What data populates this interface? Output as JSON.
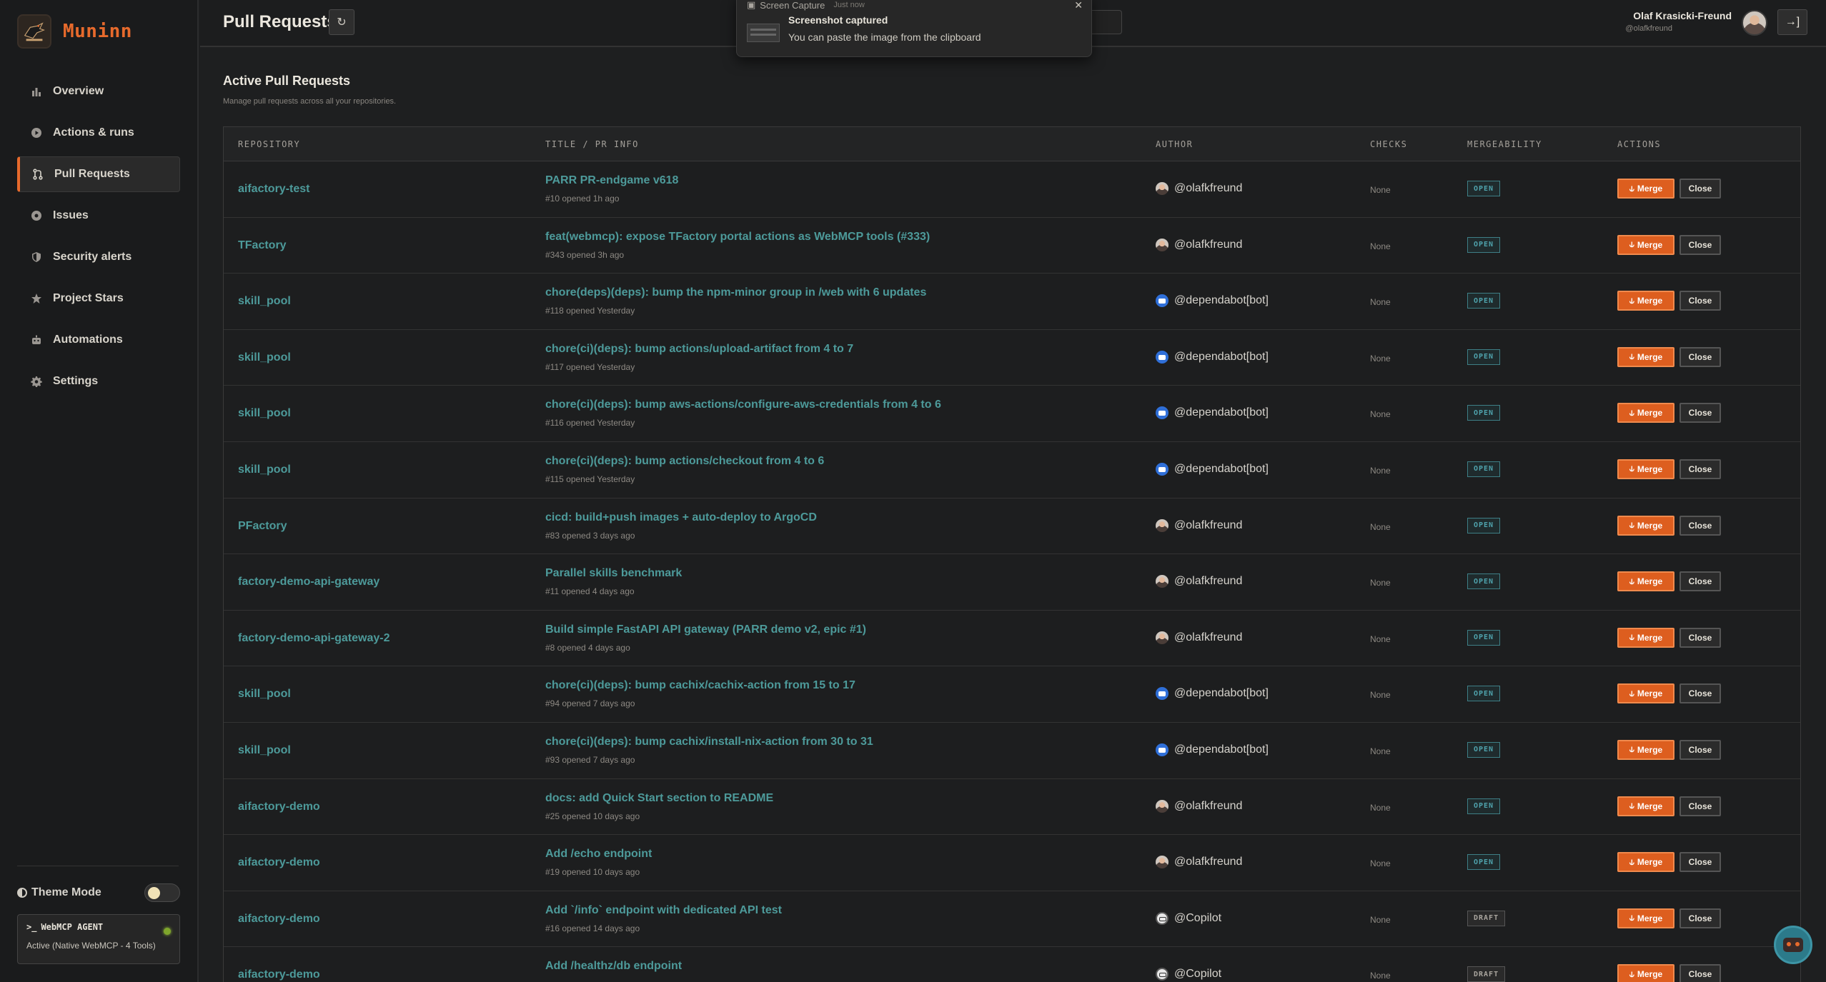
{
  "app": {
    "name": "Muninn"
  },
  "sidebar": {
    "items": [
      {
        "label": "Overview",
        "icon": "bar-chart-icon",
        "active": false
      },
      {
        "label": "Actions & runs",
        "icon": "play-circle-icon",
        "active": false
      },
      {
        "label": "Pull Requests",
        "icon": "git-pull-request-icon",
        "active": true
      },
      {
        "label": "Issues",
        "icon": "issue-dot-icon",
        "active": false
      },
      {
        "label": "Security alerts",
        "icon": "shield-icon",
        "active": false
      },
      {
        "label": "Project Stars",
        "icon": "star-icon",
        "active": false
      },
      {
        "label": "Automations",
        "icon": "robot-icon",
        "active": false
      },
      {
        "label": "Settings",
        "icon": "gear-icon",
        "active": false
      }
    ],
    "theme_label": "Theme Mode",
    "agent": {
      "title": "WebMCP AGENT",
      "status": "Active (Native WebMCP - 4 Tools)"
    }
  },
  "header": {
    "title": "Pull Requests",
    "user_name": "Olaf Krasicki-Freund",
    "user_handle": "@olafkfreund"
  },
  "toast": {
    "app": "Screen Capture",
    "time": "Just now",
    "title": "Screenshot captured",
    "body": "You can paste the image from the clipboard"
  },
  "main": {
    "title": "Active Pull Requests",
    "subtitle": "Manage pull requests across all your repositories.",
    "columns": [
      "REPOSITORY",
      "TITLE / PR INFO",
      "AUTHOR",
      "CHECKS",
      "MERGEABILITY",
      "ACTIONS"
    ],
    "merge_label": "Merge",
    "close_label": "Close",
    "rows": [
      {
        "repo": "aifactory-test",
        "title": "PARR PR-endgame v618",
        "meta": "#10 opened 1h ago",
        "author": "@olafkfreund",
        "avatar": "human",
        "checks": "None",
        "merge": "OPEN"
      },
      {
        "repo": "TFactory",
        "title": "feat(webmcp): expose TFactory portal actions as WebMCP tools (#333)",
        "meta": "#343 opened 3h ago",
        "author": "@olafkfreund",
        "avatar": "human",
        "checks": "None",
        "merge": "OPEN"
      },
      {
        "repo": "skill_pool",
        "title": "chore(deps)(deps): bump the npm-minor group in /web with 6 updates",
        "meta": "#118 opened Yesterday",
        "author": "@dependabot[bot]",
        "avatar": "bot",
        "checks": "None",
        "merge": "OPEN"
      },
      {
        "repo": "skill_pool",
        "title": "chore(ci)(deps): bump actions/upload-artifact from 4 to 7",
        "meta": "#117 opened Yesterday",
        "author": "@dependabot[bot]",
        "avatar": "bot",
        "checks": "None",
        "merge": "OPEN"
      },
      {
        "repo": "skill_pool",
        "title": "chore(ci)(deps): bump aws-actions/configure-aws-credentials from 4 to 6",
        "meta": "#116 opened Yesterday",
        "author": "@dependabot[bot]",
        "avatar": "bot",
        "checks": "None",
        "merge": "OPEN"
      },
      {
        "repo": "skill_pool",
        "title": "chore(ci)(deps): bump actions/checkout from 4 to 6",
        "meta": "#115 opened Yesterday",
        "author": "@dependabot[bot]",
        "avatar": "bot",
        "checks": "None",
        "merge": "OPEN"
      },
      {
        "repo": "PFactory",
        "title": "cicd: build+push images + auto-deploy to ArgoCD",
        "meta": "#83 opened 3 days ago",
        "author": "@olafkfreund",
        "avatar": "human",
        "checks": "None",
        "merge": "OPEN"
      },
      {
        "repo": "factory-demo-api-gateway",
        "title": "Parallel skills benchmark",
        "meta": "#11 opened 4 days ago",
        "author": "@olafkfreund",
        "avatar": "human",
        "checks": "None",
        "merge": "OPEN"
      },
      {
        "repo": "factory-demo-api-gateway-2",
        "title": "Build simple FastAPI API gateway (PARR demo v2, epic #1)",
        "meta": "#8 opened 4 days ago",
        "author": "@olafkfreund",
        "avatar": "human",
        "checks": "None",
        "merge": "OPEN"
      },
      {
        "repo": "skill_pool",
        "title": "chore(ci)(deps): bump cachix/cachix-action from 15 to 17",
        "meta": "#94 opened 7 days ago",
        "author": "@dependabot[bot]",
        "avatar": "bot",
        "checks": "None",
        "merge": "OPEN"
      },
      {
        "repo": "skill_pool",
        "title": "chore(ci)(deps): bump cachix/install-nix-action from 30 to 31",
        "meta": "#93 opened 7 days ago",
        "author": "@dependabot[bot]",
        "avatar": "bot",
        "checks": "None",
        "merge": "OPEN"
      },
      {
        "repo": "aifactory-demo",
        "title": "docs: add Quick Start section to README",
        "meta": "#25 opened 10 days ago",
        "author": "@olafkfreund",
        "avatar": "human",
        "checks": "None",
        "merge": "OPEN"
      },
      {
        "repo": "aifactory-demo",
        "title": "Add /echo endpoint",
        "meta": "#19 opened 10 days ago",
        "author": "@olafkfreund",
        "avatar": "human",
        "checks": "None",
        "merge": "OPEN"
      },
      {
        "repo": "aifactory-demo",
        "title": "Add `/info` endpoint with dedicated API test",
        "meta": "#16 opened 14 days ago",
        "author": "@Copilot",
        "avatar": "copilot",
        "checks": "None",
        "merge": "DRAFT"
      },
      {
        "repo": "aifactory-demo",
        "title": "Add /healthz/db endpoint",
        "meta": "",
        "author": "@Copilot",
        "avatar": "copilot",
        "checks": "None",
        "merge": "DRAFT"
      }
    ]
  }
}
